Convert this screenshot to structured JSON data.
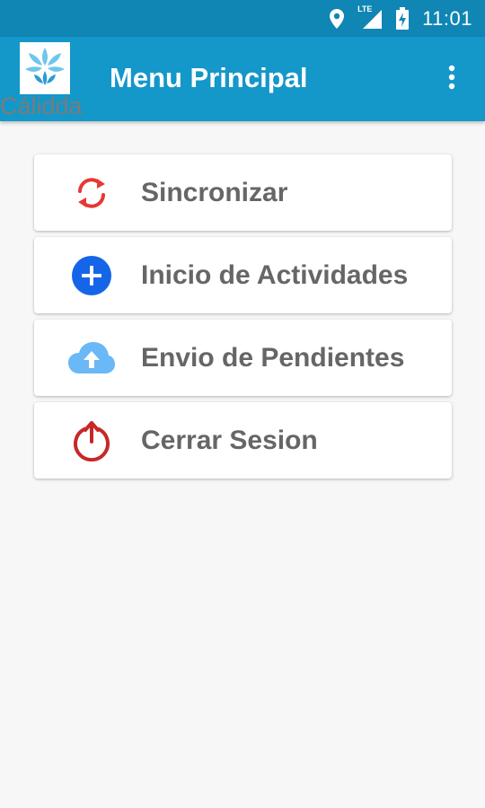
{
  "status_bar": {
    "time": "11:01",
    "network": "LTE",
    "icons": [
      "location-icon",
      "signal-icon",
      "battery-charging-icon"
    ]
  },
  "app_bar": {
    "logo_text": "Cálidda",
    "title": "Menu Principal",
    "overflow_icon": "more-vert-icon"
  },
  "menu": {
    "items": [
      {
        "label": "Sincronizar",
        "icon": "sync-icon",
        "color": "#e53935"
      },
      {
        "label": "Inicio de Actividades",
        "icon": "add-circle-icon",
        "color": "#1565e8"
      },
      {
        "label": "Envio de Pendientes",
        "icon": "cloud-upload-icon",
        "color": "#64b5f6"
      },
      {
        "label": "Cerrar Sesion",
        "icon": "power-icon",
        "color": "#c62828"
      }
    ]
  },
  "colors": {
    "status_bar": "#0f86b4",
    "app_bar": "#1497c9",
    "background": "#f7f7f7",
    "menu_text": "#666666"
  }
}
